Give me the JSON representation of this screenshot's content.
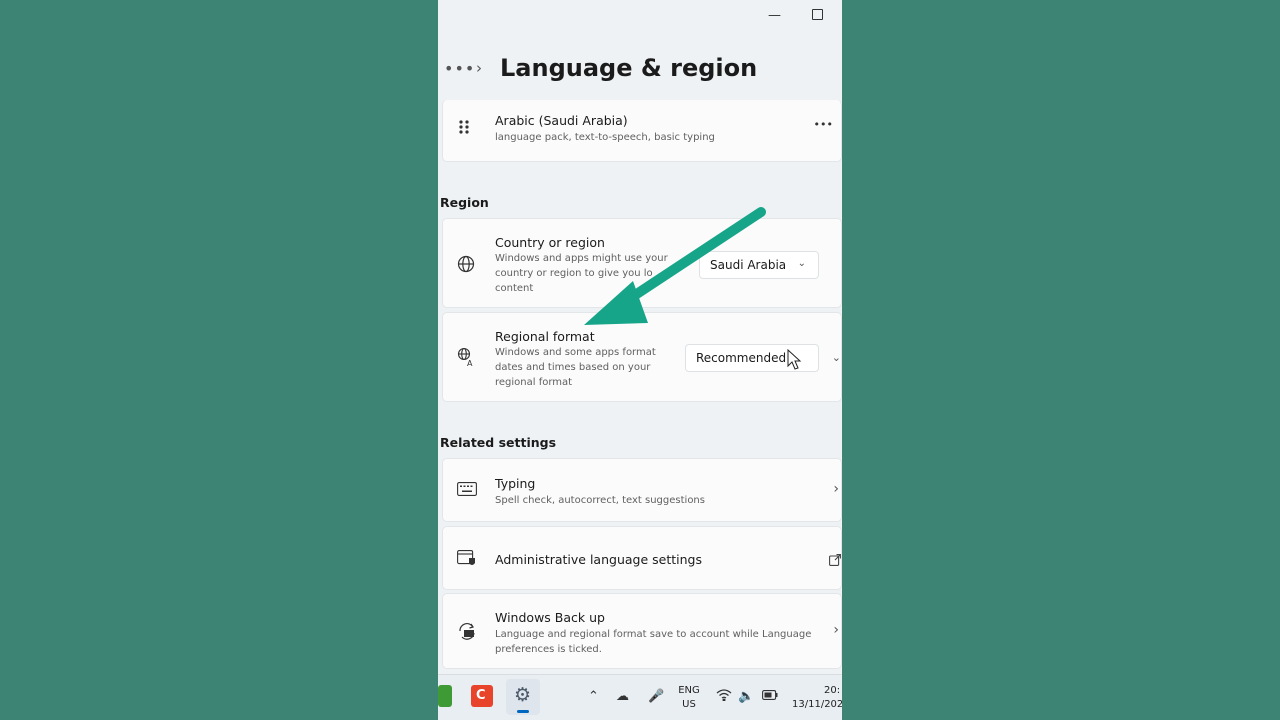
{
  "header": {
    "title": "Language & region"
  },
  "language_item": {
    "name": "Arabic (Saudi Arabia)",
    "features": "language pack, text-to-speech, basic typing"
  },
  "region": {
    "section_label": "Region",
    "country": {
      "title": "Country or region",
      "description_lines": [
        "Windows and apps might use your",
        "country or region to give you lo",
        "content"
      ],
      "value": "Saudi Arabia"
    },
    "format": {
      "title": "Regional format",
      "description_lines": [
        "Windows and some apps format",
        "dates and times based on your",
        "regional format"
      ],
      "value": "Recommended"
    }
  },
  "related": {
    "section_label": "Related settings",
    "typing": {
      "title": "Typing",
      "description": "Spell check, autocorrect, text suggestions"
    },
    "admin": {
      "title": "Administrative language settings"
    },
    "backup": {
      "title": "Windows Back up",
      "description_lines": [
        "Language and regional format save to account while Language",
        "preferences is ticked."
      ]
    }
  },
  "taskbar": {
    "lang_line1": "ENG",
    "lang_line2": "US",
    "time": "20:",
    "date": "13/11/202"
  },
  "colors": {
    "background": "#3d8474",
    "arrow": "#17a58a",
    "accent": "#0067c0"
  },
  "icons": [
    "drag-handle-icon",
    "more-icon",
    "globe-icon",
    "regional-format-icon",
    "keyboard-icon",
    "admin-icon",
    "backup-icon",
    "external-link-icon",
    "chevron-right-icon",
    "chevron-down-icon",
    "pointer-cursor",
    "annotation-arrow"
  ]
}
